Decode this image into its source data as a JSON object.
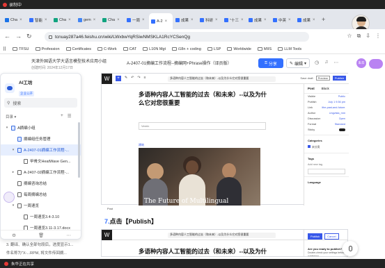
{
  "recording": {
    "label": "录制中"
  },
  "browser": {
    "tabs": [
      {
        "label": "Cha",
        "color": "#1a73e8"
      },
      {
        "label": "智能",
        "color": "#3370ff"
      },
      {
        "label": "Cha",
        "color": "#10a37f"
      },
      {
        "label": "gem",
        "color": "#4285f4"
      },
      {
        "label": "Cha",
        "color": "#10a37f"
      },
      {
        "label": "一周",
        "color": "#3370ff"
      },
      {
        "label": "A-2",
        "color": "#3370ff",
        "active": true
      },
      {
        "label": "成果",
        "color": "#3370ff"
      },
      {
        "label": "科研",
        "color": "#3370ff"
      },
      {
        "label": "\"十三",
        "color": "#3370ff"
      },
      {
        "label": "成果",
        "color": "#3370ff"
      },
      {
        "label": "中英",
        "color": "#3370ff"
      },
      {
        "label": "成果",
        "color": "#3370ff"
      }
    ],
    "url": "tcnuay287a46.feishu.cn/wiki/LWxbwYqRSiwNMSKLA1RcYCSenQg",
    "profile_name": "朱华"
  },
  "bookmarks": [
    "TFSU",
    "Profession",
    "Certificates",
    "C-Work",
    "CAT",
    "L10N Mgt",
    "i18n + coding",
    "LSP",
    "Worldwide",
    "MIIS",
    "LLM Tools"
  ],
  "header": {
    "space": "天津外国语大学大语言模型技术应用小组",
    "created": "创建时间: 2024年12月17日",
    "breadcrumb": "A-2407-01摘编工作流程--摘编网+Phrase操作（译员版）",
    "share": "分享",
    "edit": "编辑",
    "user": "朱华"
  },
  "sidebar": {
    "title": "AI工坊",
    "badge": "企业公开",
    "search": "搜索",
    "toc_label": "目录",
    "items": [
      {
        "label": "A摘编小组",
        "level": 0,
        "arrow": "▾",
        "icon": "blue",
        "selected": false
      },
      {
        "label": "摘编组任务管理",
        "level": 1,
        "arrow": "",
        "icon": "blue",
        "selected": false
      },
      {
        "label": "A-2407-01摘编工作流程-...",
        "level": 1,
        "arrow": "▾",
        "icon": "blue",
        "selected": true
      },
      {
        "label": "甲骨文HeatWave Gen...",
        "level": 2,
        "arrow": "",
        "icon": "doc",
        "selected": false
      },
      {
        "label": "A-2407-02摘编工作流程-...",
        "level": 1,
        "arrow": "▸",
        "icon": "doc",
        "selected": false
      },
      {
        "label": "摘编咨询总结",
        "level": 1,
        "arrow": "",
        "icon": "doc",
        "selected": false
      },
      {
        "label": "每周摘编总结",
        "level": 1,
        "arrow": "▸",
        "icon": "doc",
        "selected": false
      },
      {
        "label": "一周速览",
        "level": 1,
        "arrow": "▾",
        "icon": "doc",
        "selected": false
      },
      {
        "label": "一周速览3.4-3.10",
        "level": 2,
        "arrow": "",
        "icon": "doc",
        "selected": false
      },
      {
        "label": "一周速览3.11-3.17.docx",
        "level": 2,
        "arrow": "",
        "icon": "doc",
        "selected": false
      }
    ]
  },
  "doc": {
    "wp_title_bar": "多语种内容人工智能的过去（和未来）-以及为什么它对您很重要",
    "wp_heading": "多语种内容人工智能的过去（和未来）--以及为什么它对您很重要",
    "wp_input": "Verein",
    "wp_link": "建筑",
    "wp_image_text": "The Future of Multilingual",
    "wp_caption": "Post",
    "step": "7.",
    "step_text": "点击【Publish】",
    "wp_heading_2": "多语种内容人工智能的过去（和未来）--以及为什么它对您",
    "save": "Save draft",
    "preview": "Preview",
    "publish": "Publish",
    "side_tabs": [
      "Post",
      "Block"
    ],
    "side_rows": [
      {
        "k": "Visible",
        "v": "Public"
      },
      {
        "k": "Publish",
        "v": "July 1 9:36 pm"
      },
      {
        "k": "Link",
        "v": "/the-past-and-future-of-ai-for-multilingual"
      },
      {
        "k": "Author",
        "v": "Lingvista_mm"
      },
      {
        "k": "Discussion",
        "v": "Open"
      },
      {
        "k": "Format",
        "v": "Standard"
      },
      {
        "k": "Sticky",
        "v": ""
      }
    ],
    "side_categories": "Categories",
    "side_category_item": "未分类",
    "side_tags": "Tags",
    "side_tags_label": "Add new tag",
    "side_language": "Language",
    "pub_buttons": [
      "Publish",
      "Cancel"
    ],
    "pub_question": "Are you ready to publish?",
    "pub_desc": "Double-check your settings before publishing."
  },
  "bottom": {
    "line1": "3. 翻译、确认全部句段后，进度显示1...",
    "line2": "件名称为\"X-...RPM, 将文件传回摘..."
  },
  "sharebar": {
    "label": "朱华正在共享"
  }
}
